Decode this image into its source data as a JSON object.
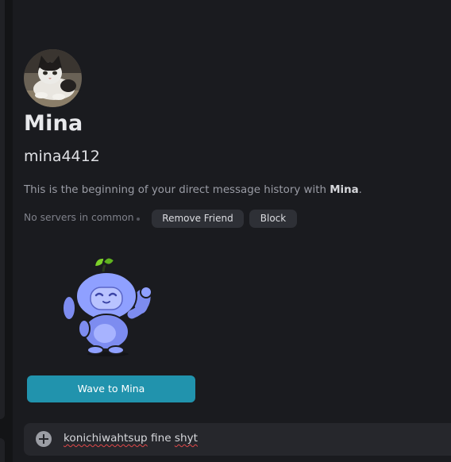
{
  "profile": {
    "display_name": "Mina",
    "username": "mina4412",
    "intro_prefix": "This is the beginning of your direct message history with ",
    "intro_name": "Mina",
    "intro_suffix": "."
  },
  "actions": {
    "mutual_servers": "No servers in common",
    "remove_friend_label": "Remove Friend",
    "block_label": "Block"
  },
  "wave": {
    "button_label": "Wave to Mina"
  },
  "composer": {
    "draft_words": [
      "konichiwahtsup",
      "fine",
      "shyt"
    ],
    "misspelled": [
      true,
      false,
      true
    ]
  },
  "colors": {
    "background": "#1a1b1f",
    "button_bg": "#2e3036",
    "wave_button": "#2193ad",
    "spellcheck": "#e0484a"
  },
  "icons": [
    "avatar-cat",
    "wumpus-wave-sticker",
    "add-attachment-icon"
  ]
}
